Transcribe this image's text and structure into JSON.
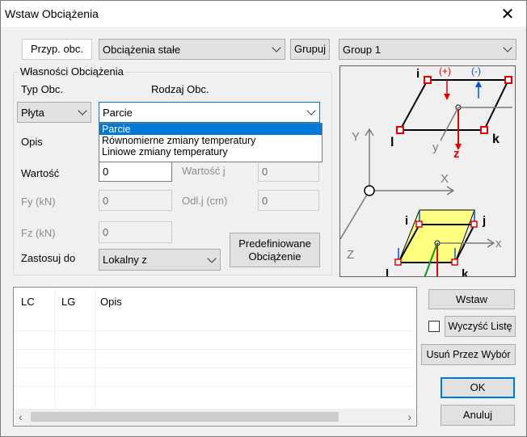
{
  "window": {
    "title": "Wstaw Obciążenia",
    "close_glyph": "✕"
  },
  "top_row": {
    "case_tab_label": "Przyp. obc.",
    "case_combo_value": "Obciążenia stałe",
    "group_button_label": "Grupuj",
    "group_combo_value": "Group 1"
  },
  "properties": {
    "group_title": "Własności Obciążenia",
    "load_type_label": "Typ Obc.",
    "load_kind_label": "Rodzaj Obc.",
    "load_type_value": "Płyta",
    "load_kind_value": "Parcie",
    "dropdown_options": [
      "Parcie",
      "Równomierne zmiany temperatury",
      "Liniowe zmiany temperatury"
    ],
    "dropdown_selected_index": 0,
    "description_label": "Opis",
    "value_label": "Wartość",
    "value_input": "0",
    "value_j_label": "Wartość j",
    "value_j_input": "0",
    "fy_label": "Fy (kN)",
    "fy_input": "0",
    "offset_j_label": "Odl.j (cm)",
    "offset_j_input": "0",
    "fz_label": "Fz (kN)",
    "fz_input": "0",
    "apply_to_label": "Zastosuj do",
    "apply_to_value": "Lokalny z",
    "predefined_button_line1": "Predefiniowane",
    "predefined_button_line2": "Obciążenie"
  },
  "preview": {
    "axis_labels": {
      "y_global": "Y",
      "x_global": "X",
      "z_global": "Z",
      "x_local": "x",
      "y_local": "y",
      "z_local": "z"
    },
    "node_labels": {
      "i": "i",
      "j": "j",
      "k": "k",
      "l": "l"
    },
    "load_markers": [
      "(+)",
      "(-)"
    ],
    "colors": {
      "red": "#e60000",
      "blue": "#0050e6",
      "green": "#00a000",
      "yellow": "#ffff80",
      "grey": "#7a7a7a"
    }
  },
  "list": {
    "columns": [
      "LC",
      "LG",
      "Opis"
    ]
  },
  "buttons": {
    "insert": "Wstaw",
    "clear_list": "Wyczyść Listę",
    "remove_selected": "Usuń Przez Wybór",
    "ok": "OK",
    "cancel": "Anuluj"
  }
}
